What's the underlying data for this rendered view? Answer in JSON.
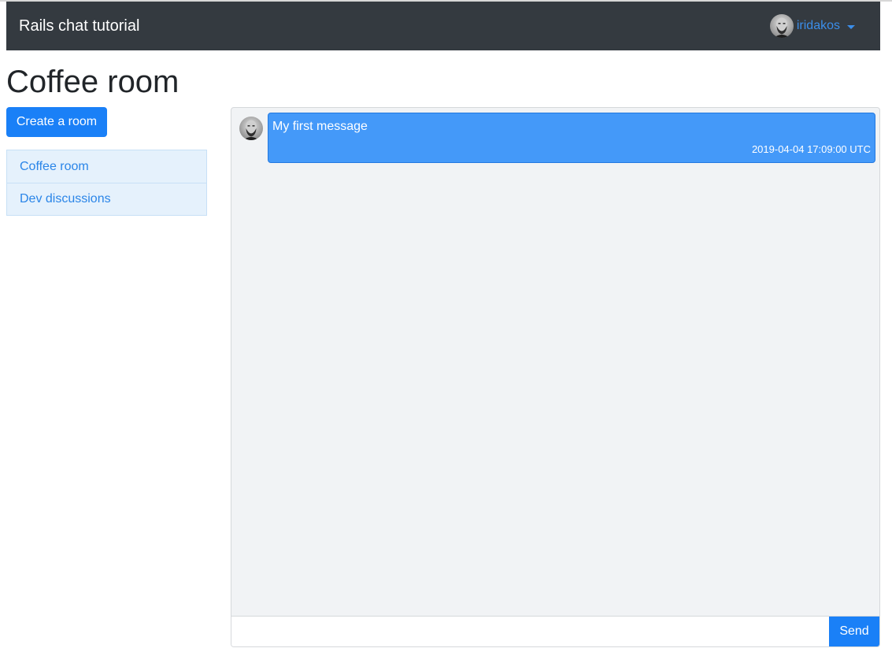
{
  "navbar": {
    "brand": "Rails chat tutorial",
    "user": {
      "name": "iridakos",
      "avatar_icon": "user-avatar-icon"
    }
  },
  "page": {
    "title": "Coffee room"
  },
  "sidebar": {
    "create_label": "Create a room",
    "rooms": [
      {
        "label": "Coffee room"
      },
      {
        "label": "Dev discussions"
      }
    ]
  },
  "chat": {
    "messages": [
      {
        "text": "My first message",
        "timestamp": "2019-04-04 17:09:00 UTC"
      }
    ],
    "input": {
      "value": "",
      "placeholder": ""
    },
    "send_label": "Send"
  },
  "colors": {
    "navbar": "#343a40",
    "primary": "#1a80f7",
    "link": "#3b8eea",
    "bubble": "#4499f9",
    "panel_bg": "#f1f3f5",
    "list_bg": "#e5f1fc"
  }
}
